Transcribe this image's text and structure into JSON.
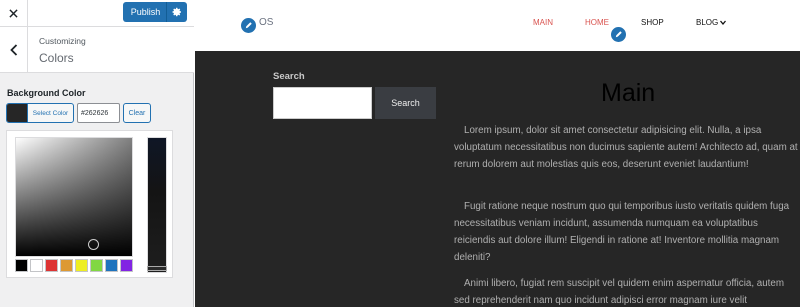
{
  "topbar": {
    "publish_label": "Publish",
    "close_icon": "close-icon",
    "gear_icon": "gear-icon"
  },
  "section": {
    "breadcrumb": "Customizing",
    "title": "Colors",
    "back_icon": "chevron-left-icon"
  },
  "color_control": {
    "label": "Background Color",
    "select_label": "Select Color",
    "hex_value": "#262626",
    "clear_label": "Clear",
    "current_color": "#262626",
    "palette": [
      "#000000",
      "#ffffff",
      "#dd3333",
      "#dd9933",
      "#eeee22",
      "#81d742",
      "#1e73be",
      "#8224e3"
    ]
  },
  "preview": {
    "logo_text": "OS",
    "nav": [
      "MAIN",
      "HOME",
      "SHOP",
      "BLOG"
    ],
    "search_label": "Search",
    "search_button": "Search",
    "page_title": "Main",
    "paragraphs": [
      "Lorem ipsum, dolor sit amet consectetur adipisicing elit. Nulla, a ipsa voluptatum necessitatibus non ducimus sapiente autem! Architecto ad, quam at rerum dolorem aut molestias quis eos, deserunt eveniet laudantium!",
      "Fugit ratione neque nostrum quo qui temporibus iusto veritatis quidem fuga necessitatibus veniam incidunt, assumenda numquam ea voluptatibus reiciendis aut dolore illum! Eligendi in ratione at! Inventore mollitia magnam deleniti?",
      "Animi libero, fugiat rem suscipit vel quidem enim aspernatur officia, autem sed reprehenderit nam quo incidunt adipisci error magnam iure velit"
    ]
  },
  "colors": {
    "accent": "#2271b1",
    "nav_active": "#d9534f",
    "preview_bg": "#262626"
  }
}
